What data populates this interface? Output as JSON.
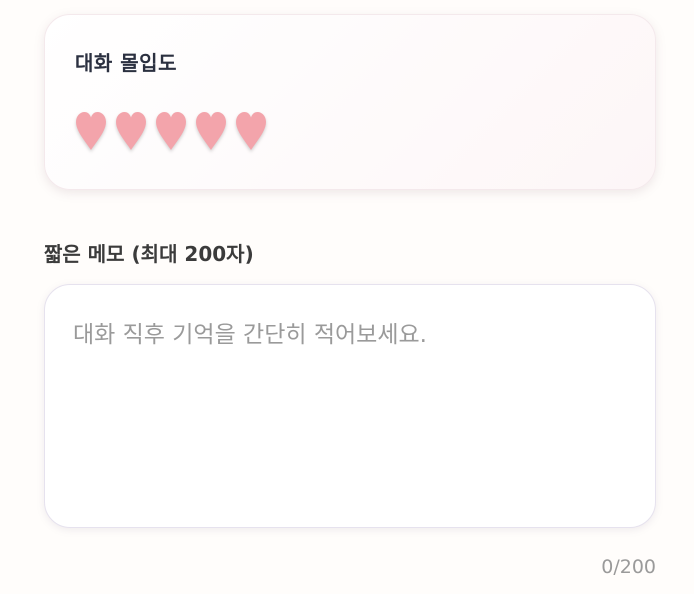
{
  "rating_card": {
    "title": "대화 몰입도",
    "rating_value": 5,
    "rating_max": 5,
    "heart_color": "#f3a4ab"
  },
  "memo": {
    "label": "짧은 메모 (최대 200자)",
    "value": "",
    "placeholder": "대화 직후 기억을 간단히 적어보세요.",
    "counter": "0/200"
  }
}
